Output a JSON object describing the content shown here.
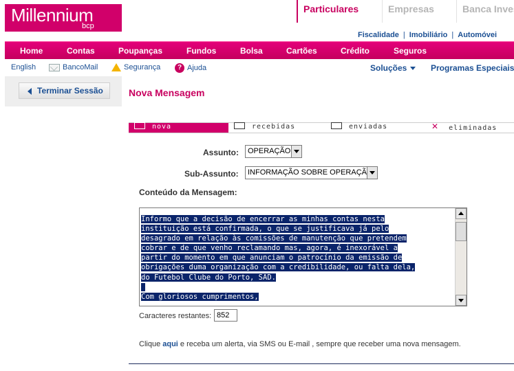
{
  "brand": {
    "name": "Millennium",
    "sub": "bcp",
    "color": "#d1006a"
  },
  "segments": [
    {
      "label": "Particulares",
      "active": true
    },
    {
      "label": "Empresas",
      "active": false
    },
    {
      "label": "Banca Invest",
      "active": false
    }
  ],
  "util_links": [
    "Fiscalidade",
    "Imobiliário",
    "Automóvei"
  ],
  "nav": [
    "Home",
    "Contas",
    "Poupanças",
    "Fundos",
    "Bolsa",
    "Cartões",
    "Crédito",
    "Seguros"
  ],
  "sub_bar": {
    "english": "English",
    "bancomail": "BancoMail",
    "seguranca": "Segurança",
    "ajuda": "Ajuda",
    "help_glyph": "?",
    "solucoes": "Soluções",
    "programas": "Programas Especiais"
  },
  "left": {
    "end_session": "Terminar Sessão"
  },
  "page_title": "Nova Mensagem",
  "msg_tabs": [
    {
      "label": "nova",
      "icon": "compose-icon",
      "active": true
    },
    {
      "label": "recebidas",
      "icon": "inbox-icon",
      "active": false
    },
    {
      "label": "enviadas",
      "icon": "outbox-icon",
      "active": false
    },
    {
      "label": "eliminadas",
      "icon": "delete-icon",
      "active": false
    }
  ],
  "form": {
    "assunto_label": "Assunto:",
    "assunto_value": "OPERAÇÃO",
    "subassunto_label": "Sub-Assunto:",
    "subassunto_value": "INFORMAÇÃO SOBRE OPERAÇÃO",
    "content_label": "Conteúdo da Mensagem:",
    "message_lines": [
      "Informo que a decisão de encerrar as minhas contas nesta",
      "instituição está confirmada, o que se justificava já pelo",
      "desagrado em relação às comissões de manutenção que pretendem",
      "cobrar e de que venho reclamando mas, agora, é inexorável a",
      "partir do momento em que anunciam o patrocínio da emissão de",
      "obrigações duma organização com a credibilidade, ou falta dela,",
      "do Futebol Clube do Porto, SAD.",
      "",
      "Com gloriosos cumprimentos,"
    ],
    "remaining_label": "Caracteres restantes:",
    "remaining_value": "852"
  },
  "alert": {
    "prefix": "Clique ",
    "link": "aqui",
    "suffix": " e receba um alerta, via SMS ou E-mail , sempre que receber uma nova mensagem."
  }
}
